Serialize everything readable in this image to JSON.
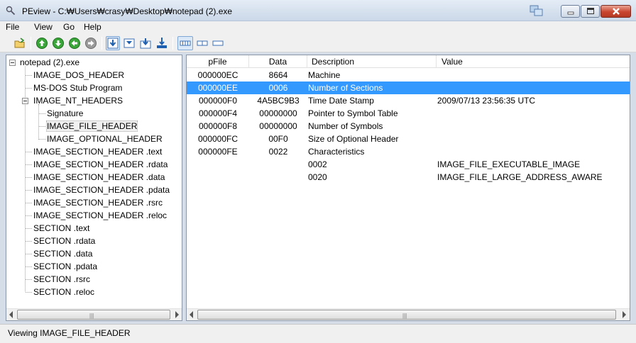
{
  "window": {
    "title": "PEview - C:₩Users₩crasy₩Desktop₩notepad (2).exe"
  },
  "menu": [
    "File",
    "View",
    "Go",
    "Help"
  ],
  "toolbar": {
    "icons": [
      "open-folder-icon",
      "up-icon",
      "down-icon",
      "back-icon",
      "forward-icon",
      "view-down-icon",
      "view-next-icon",
      "view-prev-icon",
      "view-bottom-icon",
      "byte-view-icon",
      "word-view-icon",
      "dword-view-icon"
    ]
  },
  "tree": {
    "root": "notepad (2).exe",
    "items": [
      "IMAGE_DOS_HEADER",
      "MS-DOS Stub Program",
      "IMAGE_NT_HEADERS",
      "Signature",
      "IMAGE_FILE_HEADER",
      "IMAGE_OPTIONAL_HEADER",
      "IMAGE_SECTION_HEADER .text",
      "IMAGE_SECTION_HEADER .rdata",
      "IMAGE_SECTION_HEADER .data",
      "IMAGE_SECTION_HEADER .pdata",
      "IMAGE_SECTION_HEADER .rsrc",
      "IMAGE_SECTION_HEADER .reloc",
      "SECTION .text",
      "SECTION .rdata",
      "SECTION .data",
      "SECTION .pdata",
      "SECTION .rsrc",
      "SECTION .reloc"
    ],
    "selected": "IMAGE_FILE_HEADER"
  },
  "table": {
    "columns": [
      "pFile",
      "Data",
      "Description",
      "Value"
    ],
    "rows": [
      [
        "000000EC",
        "8664",
        "Machine",
        ""
      ],
      [
        "000000EE",
        "0006",
        "Number of Sections",
        ""
      ],
      [
        "000000F0",
        "4A5BC9B3",
        "Time Date Stamp",
        "2009/07/13  23:56:35 UTC"
      ],
      [
        "000000F4",
        "00000000",
        "Pointer to Symbol Table",
        ""
      ],
      [
        "000000F8",
        "00000000",
        "Number of Symbols",
        ""
      ],
      [
        "000000FC",
        "00F0",
        "Size of Optional Header",
        ""
      ],
      [
        "000000FE",
        "0022",
        "Characteristics",
        ""
      ],
      [
        "",
        "",
        "0002",
        "IMAGE_FILE_EXECUTABLE_IMAGE"
      ],
      [
        "",
        "",
        "0020",
        "IMAGE_FILE_LARGE_ADDRESS_AWARE"
      ]
    ],
    "selected_row": 1
  },
  "status": {
    "text": "Viewing IMAGE_FILE_HEADER"
  }
}
